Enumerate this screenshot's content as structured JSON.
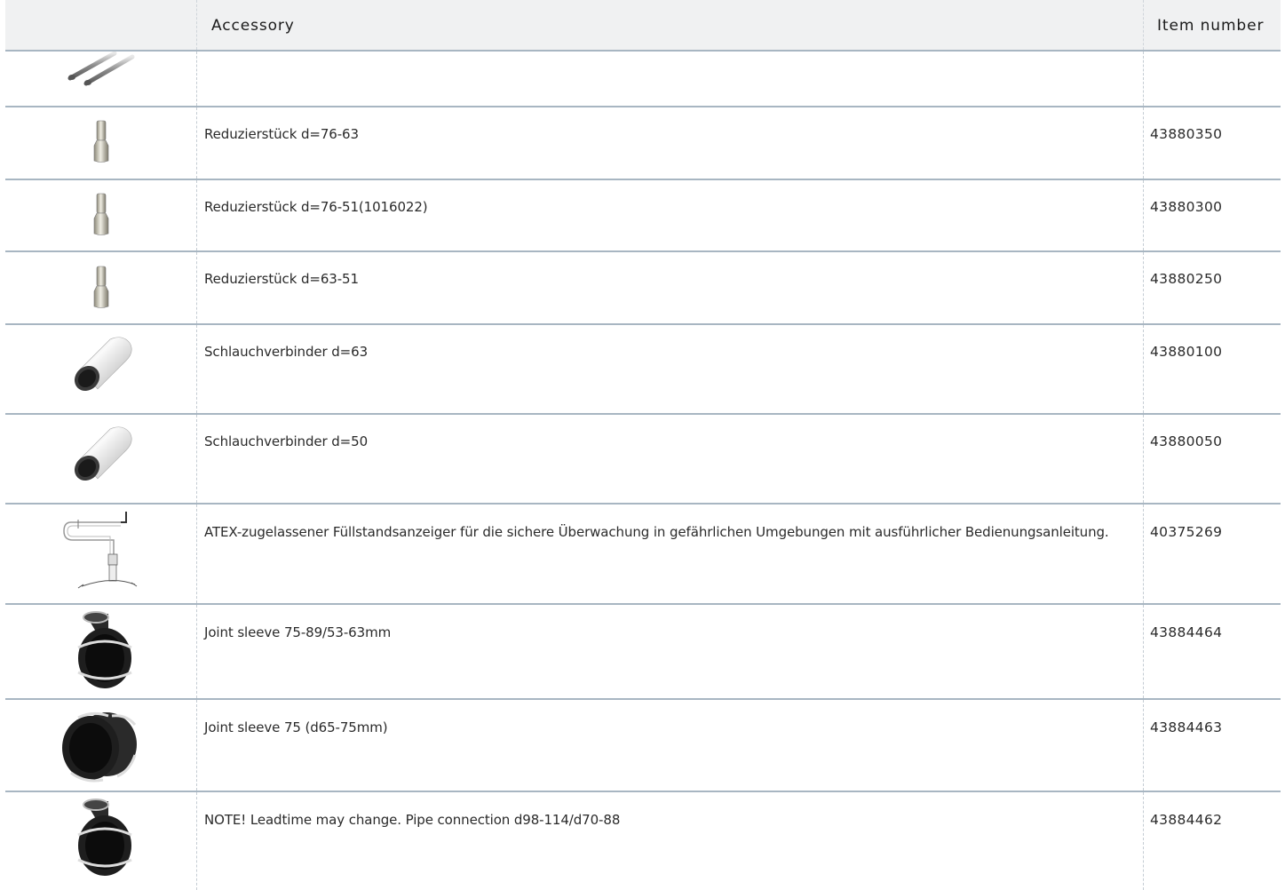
{
  "header": {
    "accessory": "Accessory",
    "item_number": "Item number"
  },
  "rows": [
    {
      "icon": "steel-tube-icon",
      "description": "",
      "item_number": ""
    },
    {
      "icon": "reducer-icon",
      "description": "Reduzierstück d=76-63",
      "item_number": "43880350"
    },
    {
      "icon": "reducer-icon",
      "description": "Reduzierstück d=76-51(1016022)",
      "item_number": "43880300"
    },
    {
      "icon": "reducer-icon",
      "description": "Reduzierstück d=63-51",
      "item_number": "43880250"
    },
    {
      "icon": "hose-connector-icon",
      "description": "Schlauchverbinder d=63",
      "item_number": "43880100"
    },
    {
      "icon": "hose-connector-icon",
      "description": "Schlauchverbinder d=50",
      "item_number": "43880050"
    },
    {
      "icon": "level-indicator-icon",
      "description": "ATEX-zugelassener Füllstandsanzeiger für die sichere Überwachung in gefährlichen Umgebungen mit ausführlicher Bedienungsanleitung.",
      "item_number": "40375269"
    },
    {
      "icon": "joint-sleeve-icon",
      "description": "Joint sleeve 75-89/53-63mm",
      "item_number": "43884464"
    },
    {
      "icon": "joint-sleeve-wide-icon",
      "description": "Joint sleeve 75 (d65-75mm)",
      "item_number": "43884463"
    },
    {
      "icon": "joint-sleeve-icon",
      "description": "NOTE! Leadtime may change. Pipe connection d98-114/d70-88",
      "item_number": "43884462"
    }
  ]
}
